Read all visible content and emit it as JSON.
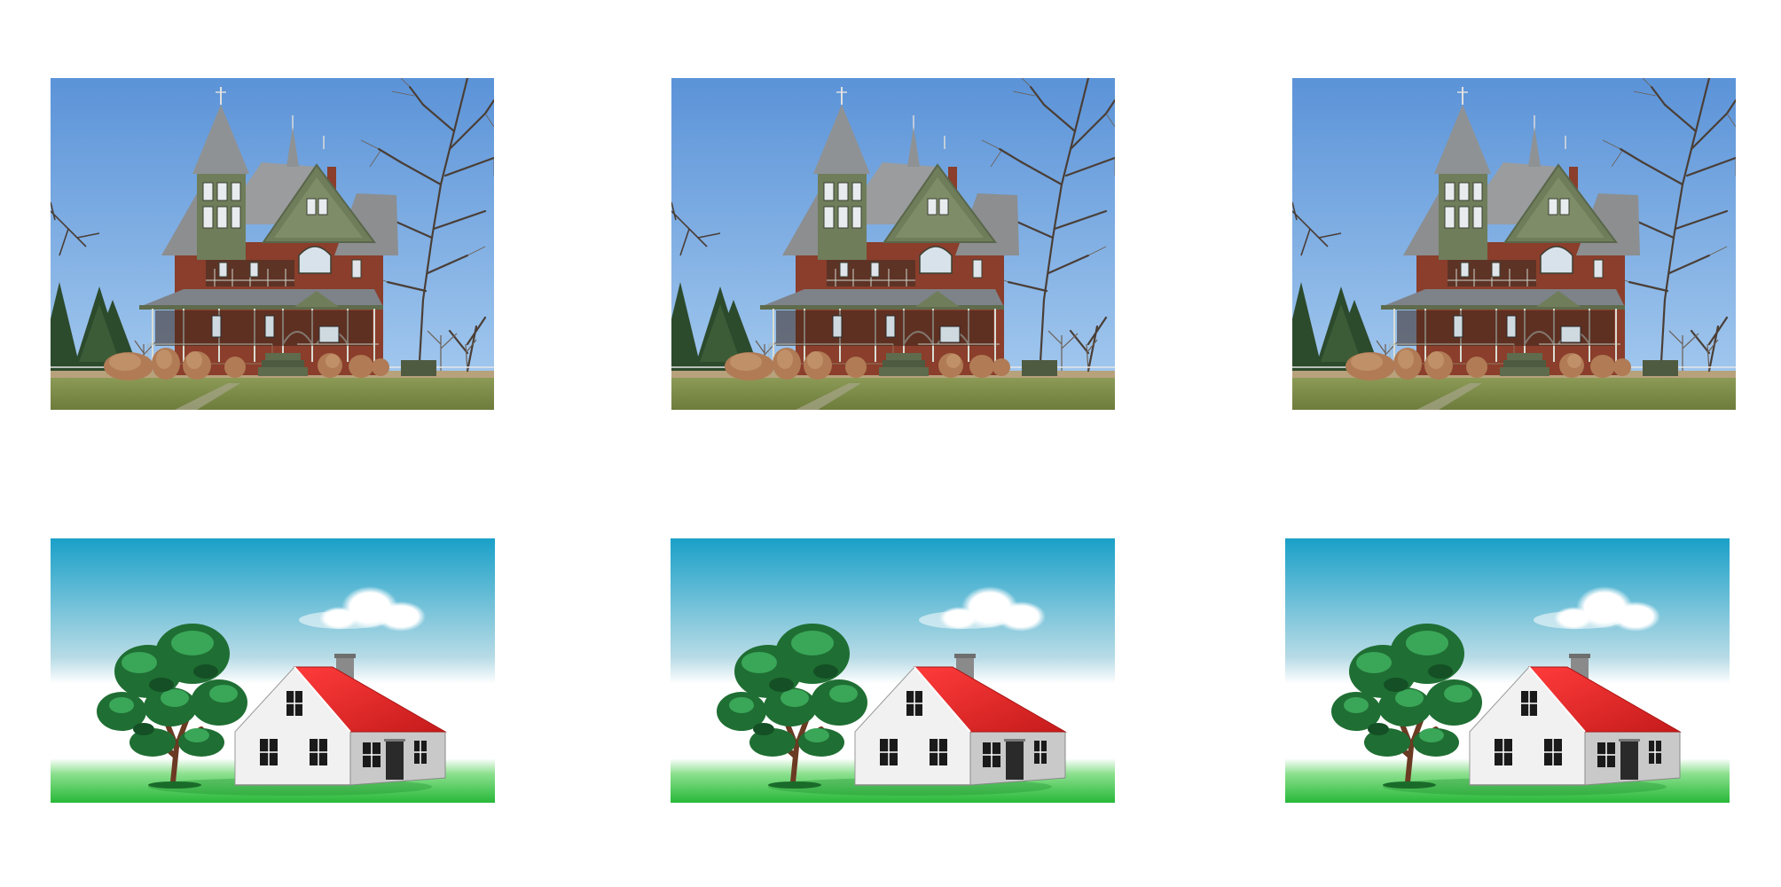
{
  "grid": {
    "rows": 2,
    "columns": 3,
    "background": "#ffffff"
  },
  "panels": [
    {
      "content": "victorian-house-photo",
      "row": 1,
      "column": 1
    },
    {
      "content": "victorian-house-photo",
      "row": 1,
      "column": 2
    },
    {
      "content": "victorian-house-photo",
      "row": 1,
      "column": 3
    },
    {
      "content": "cottage-clipart",
      "row": 2,
      "column": 1
    },
    {
      "content": "cottage-clipart",
      "row": 2,
      "column": 2
    },
    {
      "content": "cottage-clipart",
      "row": 2,
      "column": 3
    }
  ],
  "colors": {
    "photo_sky": "#5b93d8",
    "photo_grass": "#7f8f45",
    "photo_brick": "#8a3e2b",
    "photo_trim": "#6f7d5a",
    "photo_roof": "#9a9c9e",
    "clipart_sky": "#1aa0c8",
    "clipart_grass": "#3fc54a",
    "clipart_roof": "#e02b2b",
    "clipart_wall": "#f1f1f1",
    "clipart_tree": "#2f8f4a"
  }
}
